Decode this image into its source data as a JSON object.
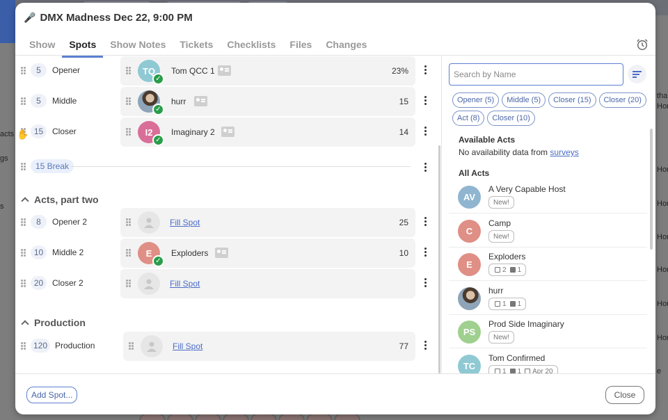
{
  "modal": {
    "title": "DMX Madness Dec 22, 9:00 PM",
    "tabs": [
      {
        "label": "Show",
        "active": false
      },
      {
        "label": "Spots",
        "active": true
      },
      {
        "label": "Show Notes",
        "active": false
      },
      {
        "label": "Tickets",
        "active": false
      },
      {
        "label": "Checklists",
        "active": false
      },
      {
        "label": "Files",
        "active": false
      },
      {
        "label": "Changes",
        "active": false
      }
    ]
  },
  "spots": {
    "rows": [
      {
        "num": "5",
        "name": "Opener",
        "act": {
          "initials": "TQ",
          "name": "Tom QCC 1",
          "value": "23%",
          "confirmed": true,
          "contact": true,
          "color": "#8fc9d3"
        }
      },
      {
        "num": "5",
        "name": "Middle",
        "act": {
          "initials": "",
          "name": "hurr",
          "value": "15",
          "confirmed": true,
          "contact": true,
          "photo": true
        }
      },
      {
        "num": "15",
        "name": "Closer",
        "act": {
          "initials": "I2",
          "name": "Imaginary 2",
          "value": "14",
          "confirmed": true,
          "contact": true,
          "color": "#d96f98"
        }
      }
    ],
    "break_label": "15 Break",
    "section2": {
      "title": "Acts, part two",
      "rows": [
        {
          "num": "8",
          "name": "Opener 2",
          "fill": "Fill Spot",
          "value": "25"
        },
        {
          "num": "10",
          "name": "Middle 2",
          "act": {
            "initials": "E",
            "name": "Exploders",
            "value": "10",
            "confirmed": true,
            "contact": true,
            "color": "#df8f85"
          }
        },
        {
          "num": "20",
          "name": "Closer 2",
          "fill": "Fill Spot",
          "value": ""
        }
      ]
    },
    "section3": {
      "title": "Production",
      "rows": [
        {
          "num": "120",
          "name": "Production",
          "fill": "Fill Spot",
          "value": "77"
        }
      ]
    }
  },
  "panel": {
    "search_placeholder": "Search by Name",
    "chips": [
      "Opener (5)",
      "Middle (5)",
      "Closer (15)",
      "Closer (20)",
      "Act (8)",
      "Closer (10)"
    ],
    "available_heading": "Available Acts",
    "no_data_text": "No availability data from",
    "surveys_link": "surveys",
    "all_heading": "All Acts",
    "acts": [
      {
        "initials": "AV",
        "name": "A Very Capable Host",
        "tag": "New!",
        "color": "#8fb5d0"
      },
      {
        "initials": "C",
        "name": "Camp",
        "tag": "New!",
        "color": "#df8f85"
      },
      {
        "initials": "E",
        "name": "Exploders",
        "counts": [
          "2",
          "1"
        ],
        "color": "#df8f85"
      },
      {
        "initials": "",
        "name": "hurr",
        "counts": [
          "1",
          "1"
        ],
        "photo": true
      },
      {
        "initials": "PS",
        "name": "Prod Side Imaginary",
        "tag": "New!",
        "color": "#9fd08e"
      },
      {
        "initials": "TC",
        "name": "Tom Confirmed",
        "counts": [
          "1",
          "1"
        ],
        "date": "Apr 20",
        "color": "#8fc9d3"
      }
    ]
  },
  "footer": {
    "add_label": "Add Spot...",
    "close_label": "Close"
  },
  "background": {
    "left_labels": [
      "acts",
      "gs",
      "s"
    ],
    "right_labels": [
      "tha",
      "Hor",
      "Hor",
      "Hor",
      "Hor",
      "Hor",
      "Hor",
      "Hor",
      "e"
    ]
  }
}
